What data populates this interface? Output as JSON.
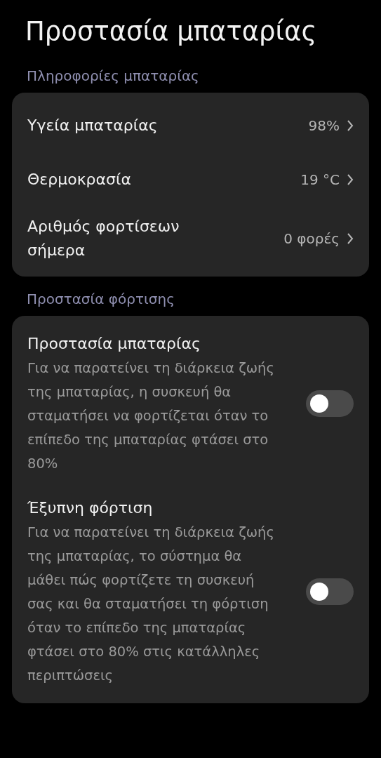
{
  "title": "Προστασία μπαταρίας",
  "sections": [
    {
      "header": "Πληροφορίες μπαταρίας",
      "kind": "info",
      "rows": [
        {
          "label": "Υγεία μπαταρίας",
          "value": "98%"
        },
        {
          "label": "Θερμοκρασία",
          "value": "19 °C"
        },
        {
          "label": "Αριθμός φορτίσεων σήμερα",
          "value": "0 φορές"
        }
      ]
    },
    {
      "header": "Προστασία φόρτισης",
      "kind": "toggles",
      "rows": [
        {
          "label": "Προστασία μπαταρίας",
          "description": "Για να παρατείνει τη διάρκεια ζωής της μπαταρίας, η συσκευή θα σταματήσει να φορτίζεται όταν το επίπεδο της μπαταρίας φτάσει στο 80%",
          "on": false
        },
        {
          "label": "Έξυπνη φόρτιση",
          "description": "Για να παρατείνει τη διάρκεια ζωής της μπαταρίας, το σύστημα θα μάθει πώς φορτίζετε τη συσκευή σας και θα σταματήσει τη φόρτιση όταν το επίπεδο της μπαταρίας φτάσει στο 80% στις κατάλληλες περιπτώσεις",
          "on": false
        }
      ]
    }
  ]
}
